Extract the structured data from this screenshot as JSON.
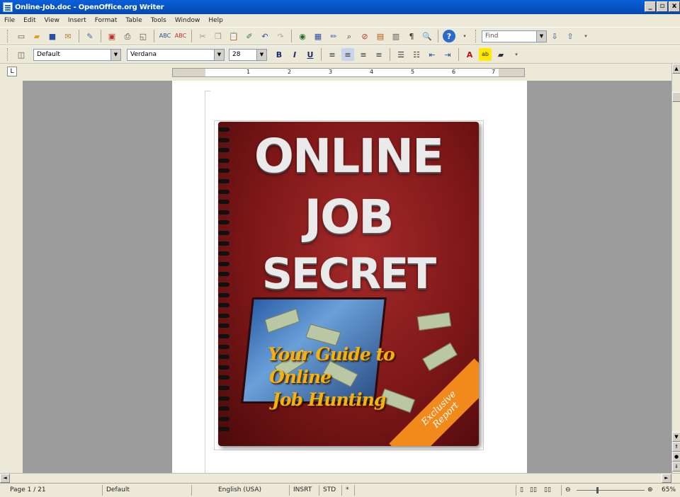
{
  "window": {
    "title": "Online-Job.doc - OpenOffice.org Writer",
    "min_label": "_",
    "restore_label": "ð",
    "close_label": "x"
  },
  "menu": [
    "File",
    "Edit",
    "View",
    "Insert",
    "Format",
    "Table",
    "Tools",
    "Window",
    "Help"
  ],
  "toolbar": {
    "find_placeholder": "Find",
    "paragraph_style": "Default",
    "font_name": "Verdana",
    "font_size": "28",
    "bold_label": "B",
    "italic_label": "I",
    "underline_label": "U"
  },
  "ruler": {
    "tab_selector": "L",
    "numbers": [
      "1",
      "2",
      "3",
      "4",
      "5",
      "6",
      "7"
    ]
  },
  "cover": {
    "line1": "ONLINE",
    "line2": "JOB",
    "line3": "SECRET",
    "sub1": "Your Guide to",
    "sub2": "Online",
    "sub3": "Job Hunting",
    "badge1": "Exclusive",
    "badge2": "Report",
    "colors": {
      "background": "#7d1717",
      "title": "#eaeaea",
      "subtitle": "#f3b20e",
      "badge": "#f28a1b"
    }
  },
  "status": {
    "page": "Page 1 / 21",
    "style": "Default",
    "language": "English (USA)",
    "insert_mode": "INSRT",
    "selection_mode": "STD",
    "star": "*",
    "zoom": "65%"
  }
}
